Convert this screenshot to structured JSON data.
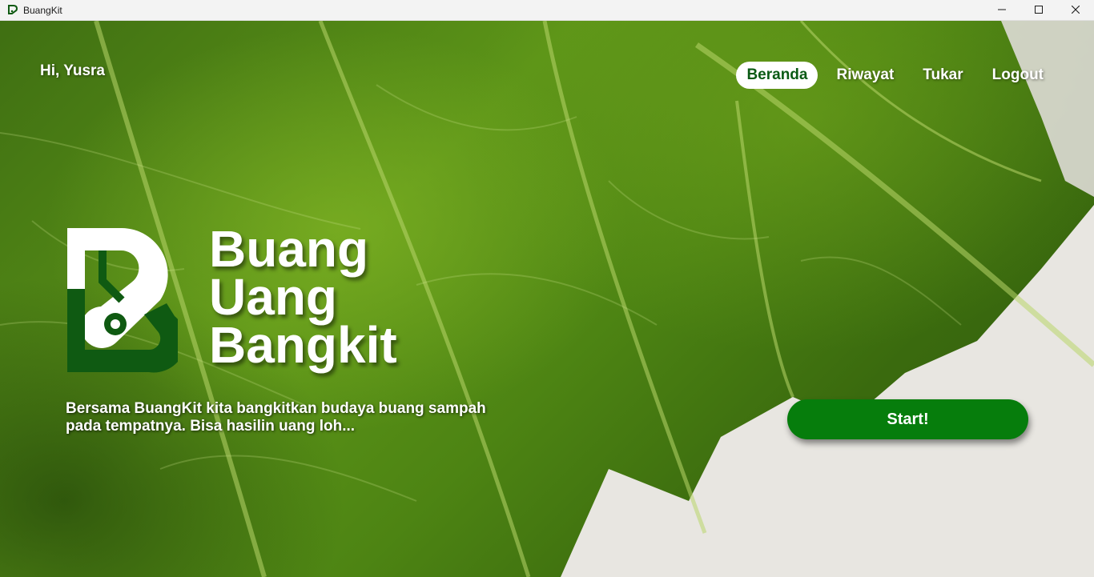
{
  "window": {
    "title": "BuangKit",
    "icon": "buangkit-logo-icon",
    "controls": [
      "minimize-icon",
      "maximize-icon",
      "close-icon"
    ]
  },
  "header": {
    "greeting": "Hi, Yusra"
  },
  "nav": {
    "items": [
      {
        "label": "Beranda",
        "active": true
      },
      {
        "label": "Riwayat",
        "active": false
      },
      {
        "label": "Tukar",
        "active": false
      },
      {
        "label": "Logout",
        "active": false
      }
    ]
  },
  "hero": {
    "headline": [
      "Buang",
      "Uang",
      "Bangkit"
    ],
    "tagline_line1": "Bersama BuangKit kita bangkitkan budaya buang sampah",
    "tagline_line2": "pada tempatnya. Bisa hasilin uang loh...",
    "start_label": "Start!"
  },
  "colors": {
    "brand_green": "#067d0c",
    "nav_active_text": "#0a5a14",
    "logo_dark_green": "#0f5a12",
    "logo_white": "#ffffff"
  }
}
